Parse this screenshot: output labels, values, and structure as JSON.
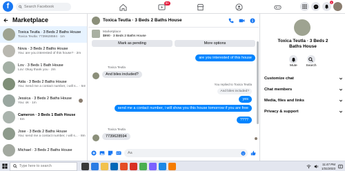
{
  "topbar": {
    "search_placeholder": "Search Facebook",
    "watch_badge": "9+",
    "notifications_badge": "1"
  },
  "sidebar": {
    "title": "Marketplace",
    "items": [
      {
        "name": "Toxica Teutla · 3 Beds 2 Baths House",
        "snippet": "Toxica Teutla: 7739628594 · 1m",
        "active": true,
        "bold": false,
        "avatar_color": "#9ea391"
      },
      {
        "name": "Nova · 3 Beds 2 Baths House",
        "snippet": "You: are you interested of this house? · 2m",
        "active": false,
        "bold": false,
        "avatar_color": "#b9b8b0"
      },
      {
        "name": "Lov · 3 Beds 1 Bath House",
        "snippet": "Lov: Okay thank you · 2m",
        "active": false,
        "bold": false,
        "avatar_color": "#a4b0a5"
      },
      {
        "name": "Aida · 3 Beds 2 Baths House",
        "snippet": "You: Send me a contact number, i will s... · 5m",
        "active": false,
        "bold": false,
        "avatar_color": "#7f8f78"
      },
      {
        "name": "Jessica · 3 Beds 2 Baths House",
        "snippet": "You: ok · 1m",
        "active": false,
        "bold": false,
        "avatar_color": "#9aa7a0"
      },
      {
        "name": "Cameron · 3 Beds 1 Bath House",
        "snippet": "· 6m",
        "active": false,
        "bold": true,
        "avatar_color": "#aab4ad"
      },
      {
        "name": "Jose · 3 Beds 2 Baths House",
        "snippet": "You: send me a contact number, i will s... · 8m",
        "active": false,
        "bold": false,
        "avatar_color": "#8e9b8c"
      },
      {
        "name": "Michael · 3 Beds 2 Baths House",
        "snippet": "",
        "active": false,
        "bold": false,
        "avatar_color": "#a3a9a0"
      }
    ]
  },
  "chat": {
    "title": "Toxica Teutla · 3 Beds 2 Baths House",
    "marketplace_label": "Marketplace",
    "listing_price": "$990 · 3 Beds 2 Baths House",
    "mark_pending": "Mark as pending",
    "more_options": "More options",
    "messages": {
      "out1": "are you interested of this house",
      "sender1": "Toxica Teutla",
      "in1": "And biles included?",
      "reply_note": "You replied to Toxica Teutla",
      "quoted": "And biles included?",
      "out2": "yes",
      "out3": "send me a contact number, i will show you this house tomorrow if you are free",
      "out4": "????",
      "sender2": "Toxica Teutla",
      "in2": "7739628594"
    },
    "composer_placeholder": "Aa"
  },
  "right_panel": {
    "name": "Toxica Teutla · 3 Beds 2 Baths House",
    "mute_label": "Mute",
    "search_label": "Search",
    "sections": [
      "Customize chat",
      "Chat members",
      "Media, files and links",
      "Privacy & support"
    ]
  },
  "taskbar": {
    "search_placeholder": "Type here to search",
    "time": "11:47 PM",
    "date": "1/31/2023"
  },
  "colors": {
    "brand_blue": "#1877f2",
    "bubble_out": "#0084ff",
    "bubble_in": "#e4e6eb",
    "active_row": "#e7f3ff"
  }
}
